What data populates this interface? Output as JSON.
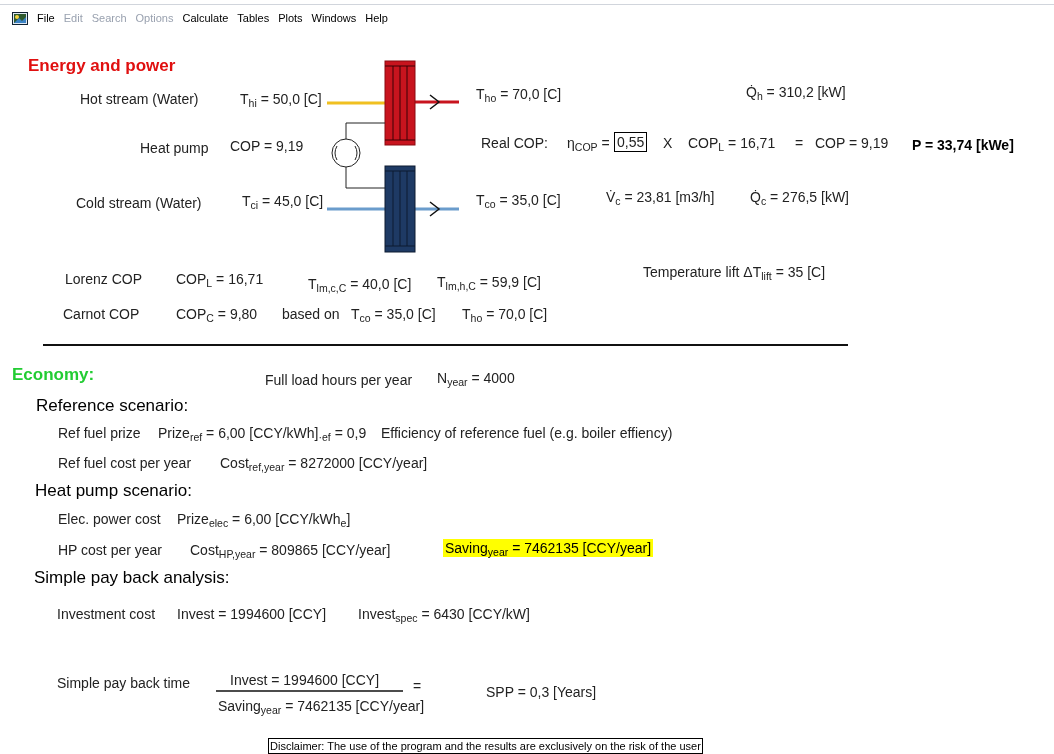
{
  "menu": [
    {
      "label": "File",
      "disabled": false
    },
    {
      "label": "Edit",
      "disabled": true
    },
    {
      "label": "Search",
      "disabled": true
    },
    {
      "label": "Options",
      "disabled": true
    },
    {
      "label": "Calculate",
      "disabled": false
    },
    {
      "label": "Tables",
      "disabled": false
    },
    {
      "label": "Plots",
      "disabled": false
    },
    {
      "label": "Windows",
      "disabled": false
    },
    {
      "label": "Help",
      "disabled": false
    }
  ],
  "energy": {
    "items": [
      {
        "kind": "heading",
        "text": "Energy and power"
      },
      {
        "kind": "label",
        "text": "Hot stream (Water)"
      },
      {
        "kind": "value",
        "text": "T$_{hi}$ = 50,0 [C]"
      },
      {
        "kind": "value",
        "text": "T$_{ho}$ = 70,0 [C]"
      },
      {
        "kind": "value",
        "text": "Q̇$_{h}$ = 310,2 [kW]"
      },
      {
        "kind": "label",
        "text": "Heat pump"
      },
      {
        "kind": "value",
        "text": "COP = 9,19"
      },
      {
        "kind": "label",
        "text": "Real COP:"
      },
      {
        "kind": "value",
        "text": "η$_{COP}$ ="
      },
      {
        "kind": "boxed",
        "text": "0,55"
      },
      {
        "kind": "value",
        "text": "X"
      },
      {
        "kind": "value",
        "text": "COP$_{L}$ = 16,71"
      },
      {
        "kind": "value",
        "text": "="
      },
      {
        "kind": "value",
        "text": "COP = 9,19"
      },
      {
        "kind": "bold",
        "text": "P = 33,74 [kWe]"
      },
      {
        "kind": "label",
        "text": "Cold stream (Water)"
      },
      {
        "kind": "value",
        "text": "T$_{ci}$ = 45,0 [C]"
      },
      {
        "kind": "value",
        "text": "T$_{co}$ = 35,0 [C]"
      },
      {
        "kind": "value",
        "text": "V̇$_{c}$ = 23,81 [m3/h]"
      },
      {
        "kind": "value",
        "text": "Q̇$_{c}$ = 276,5 [kW]"
      },
      {
        "kind": "label",
        "text": "Lorenz COP"
      },
      {
        "kind": "value",
        "text": "COP$_{L}$ = 16,71"
      },
      {
        "kind": "value",
        "text": "T$_{lm,c,C}$ = 40,0 [C]"
      },
      {
        "kind": "value",
        "text": "T$_{lm,h,C}$ = 59,9 [C]"
      },
      {
        "kind": "value",
        "text": "Temperature lift ΔT$_{lift}$ = 35 [C]"
      },
      {
        "kind": "label",
        "text": "Carnot COP"
      },
      {
        "kind": "value",
        "text": "COP$_{C}$ = 9,80"
      },
      {
        "kind": "label",
        "text": "based on"
      },
      {
        "kind": "value",
        "text": "T$_{co}$ = 35,0 [C]"
      },
      {
        "kind": "value",
        "text": "T$_{ho}$ = 70,0 [C]"
      }
    ]
  },
  "economy": {
    "items": [
      {
        "kind": "heading",
        "text": "Economy:"
      },
      {
        "kind": "label",
        "text": "Full load hours per year"
      },
      {
        "kind": "value",
        "text": "N$_{year}$ = 4000"
      },
      {
        "kind": "subheading",
        "text": "Reference scenario:"
      },
      {
        "kind": "label",
        "text": "Ref fuel prize"
      },
      {
        "kind": "value",
        "text": "Prize$_{ref}$ = 6,00 [CCY/kWh]$_{·ef}$ = 0,9"
      },
      {
        "kind": "label",
        "text": "Efficiency of reference fuel (e.g. boiler effiency)"
      },
      {
        "kind": "label",
        "text": "Ref fuel cost per year"
      },
      {
        "kind": "value",
        "text": "Cost$_{ref,year}$ = 8272000 [CCY/year]"
      },
      {
        "kind": "subheading",
        "text": "Heat pump scenario:"
      },
      {
        "kind": "label",
        "text": "Elec. power cost"
      },
      {
        "kind": "value",
        "text": "Prize$_{elec}$ = 6,00 [CCY/kWh$_{e}$]"
      },
      {
        "kind": "label",
        "text": "HP cost per year"
      },
      {
        "kind": "value",
        "text": "Cost$_{HP,year}$ = 809865 [CCY/year]"
      },
      {
        "kind": "highlight",
        "text": "Saving$_{year}$ = 7462135 [CCY/year]"
      },
      {
        "kind": "subheading",
        "text": "Simple pay back analysis:"
      },
      {
        "kind": "label",
        "text": "Investment cost"
      },
      {
        "kind": "value",
        "text": "Invest = 1994600 [CCY]"
      },
      {
        "kind": "value",
        "text": "Invest$_{spec}$ = 6430 [CCY/kW]"
      },
      {
        "kind": "label",
        "text": "Simple pay back time"
      },
      {
        "kind": "value",
        "text": "Invest = 1994600 [CCY]"
      },
      {
        "kind": "value",
        "text": "="
      },
      {
        "kind": "value",
        "text": "Saving$_{year}$ = 7462135 [CCY/year]"
      },
      {
        "kind": "value",
        "text": "SPP = 0,3 [Years]"
      }
    ]
  },
  "disclaimer": "Disclaimer: The use of the program and the results are exclusively on the risk of the user"
}
